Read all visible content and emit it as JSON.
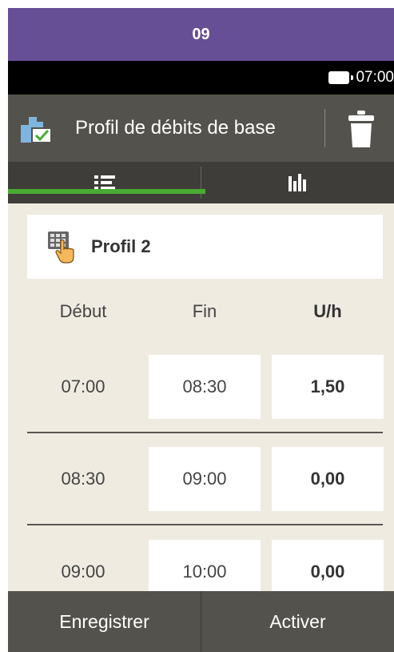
{
  "banner": {
    "label": "09",
    "color": "#674f96"
  },
  "status_bar": {
    "battery_icon": "battery-icon",
    "time": "07:00"
  },
  "header": {
    "title": "Profil de débits de base",
    "title_icon": "basal-profile-icon",
    "delete_icon": "trash-icon"
  },
  "tabs": [
    {
      "icon": "list-icon",
      "selected": true
    },
    {
      "icon": "bar-chart-icon",
      "selected": false
    }
  ],
  "profile": {
    "name": "Profil 2",
    "icon": "keypad-hand-icon"
  },
  "columns": {
    "start": "Début",
    "end": "Fin",
    "rate": "U/h"
  },
  "rows": [
    {
      "start": "07:00",
      "end": "08:30",
      "rate": "1,50"
    },
    {
      "start": "08:30",
      "end": "09:00",
      "rate": "0,00"
    },
    {
      "start": "09:00",
      "end": "10:00",
      "rate": "0,00"
    }
  ],
  "footer": {
    "save": "Enregistrer",
    "activate": "Activer"
  },
  "colors": {
    "accent_green": "#4aab33",
    "header_gray": "#54524c",
    "content_bg": "#efebe1"
  }
}
